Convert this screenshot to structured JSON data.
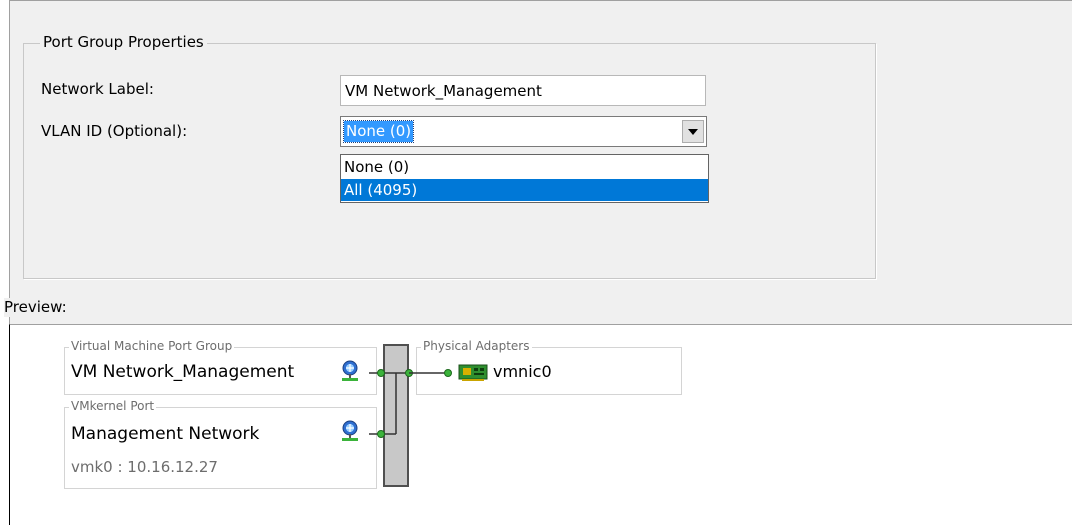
{
  "port_group_properties": {
    "title": "Port Group Properties",
    "network_label": {
      "label": "Network Label:",
      "value": "VM Network_Management"
    },
    "vlan_id": {
      "label": "VLAN ID (Optional):",
      "selected": "None (0)",
      "options": [
        "None (0)",
        "All (4095)"
      ],
      "highlighted_option": "All (4095)"
    }
  },
  "preview": {
    "label": "Preview:",
    "vm_port_group": {
      "title": "Virtual Machine Port Group",
      "name": "VM Network_Management",
      "icon": "network-port-icon"
    },
    "vmkernel_port": {
      "title": "VMkernel Port",
      "name": "Management Network",
      "address": "vmk0 : 10.16.12.27",
      "icon": "network-port-icon"
    },
    "physical_adapters": {
      "title": "Physical Adapters",
      "adapter": "vmnic0",
      "icon": "nic-card-icon"
    }
  },
  "colors": {
    "selection": "#3399ff",
    "dropdown_highlight": "#0078d7",
    "link_green": "#2a9b2a",
    "panel_bg": "#f0f0f0"
  }
}
